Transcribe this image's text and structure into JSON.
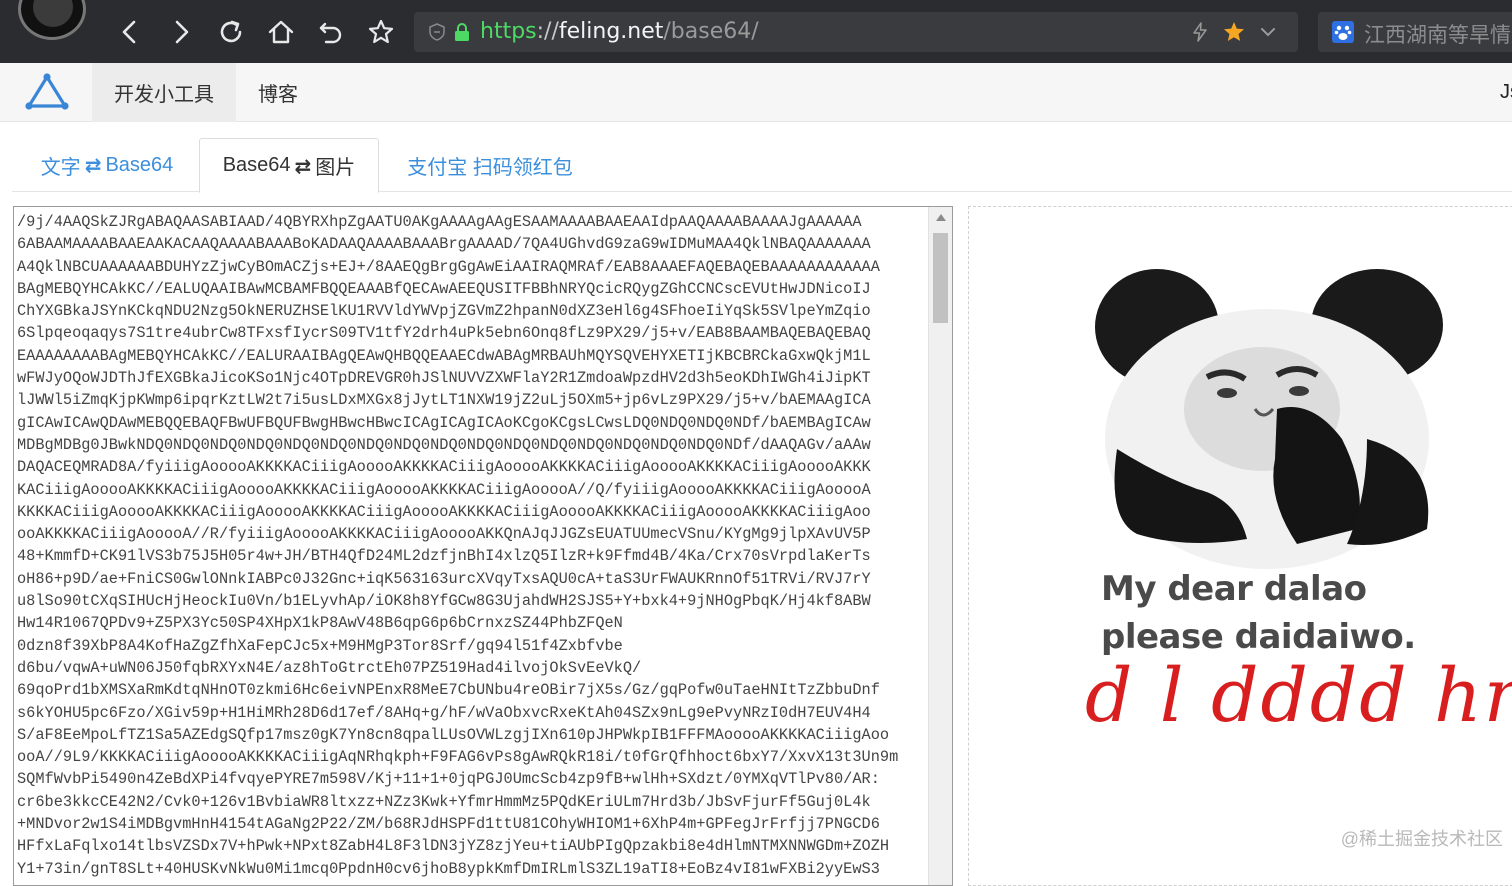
{
  "browser": {
    "url": {
      "scheme": "https",
      "sep": "://",
      "host": "feling.net",
      "path": "/base64/"
    },
    "search_text": "江西湖南等旱情加",
    "colors": {
      "url_green": "#4cd964",
      "star": "#f5a623",
      "chrome_bg": "#2b2c30"
    }
  },
  "site": {
    "menu": [
      {
        "label": "开发小工具"
      },
      {
        "label": "博客"
      }
    ],
    "right_text": "Js"
  },
  "tabs": [
    {
      "text": "文字",
      "arrow": "⇄",
      "text2": "Base64"
    },
    {
      "text": "Base64",
      "arrow": "⇄",
      "text2": "图片"
    },
    {
      "text": "支付宝 扫码领红包"
    }
  ],
  "base64_lines": [
    "/9j/4AAQSkZJRgABAQAASABIAAD/4QBYRXhpZgAATU0AKgAAAAgAAgESAAMAAAABAAEAAIdpAAQAAAABAAAAJgAAAAAA",
    "6ABAAMAAAABAAEAAKACAAQAAAABAAABoKADAAQAAAABAAABrgAAAAD/7QA4UGhvdG9zaG9wIDMuMAA4QklNBAQAAAAAAA",
    "A4QklNBCUAAAAAABDUHYzZjwCyBOmACZjs+EJ+/8AAEQgBrgGgAwEiAAIRAQMRAf/EAB8AAAEFAQEBAQEBAAAAAAAAAAAA",
    "BAgMEBQYHCAkKC//EALUQAAIBAwMCBAMFBQQEAAABfQECAwAEEQUSITFBBhNRYQcicRQygZGhCCNCscEVUtHwJDNicoIJ",
    "ChYXGBkaJSYnKCkqNDU2Nzg5OkNERUZHSElKU1RVVldYWVpjZGVmZ2hpanN0dXZ3eHl6g4SFhoeIiYqSk5SVlpeYmZqio",
    "6Slpqeoqaqys7S1tre4ubrCw8TFxsfIycrS09TV1tfY2drh4uPk5ebn6Onq8fLz9PX29/j5+v/EAB8BAAMBAQEBAQEBAQ",
    "EAAAAAAAABAgMEBQYHCAkKC//EALURAAIBAgQEAwQHBQQEAAECdwABAgMRBAUhMQYSQVEHYXETIjKBCBRCkaGxwQkjM1L",
    "wFWJyOQoWJDThJfEXGBkaJicoKSo1Njc4OTpDREVGR0hJSlNUVVZXWFlaY2R1ZmdoaWpzdHV2d3h5eoKDhIWGh4iJipKT",
    "lJWWl5iZmqKjpKWmp6ipqrKztLW2t7i5usLDxMXGx8jJytLT1NXW19jZ2uLj5OXm5+jp6vLz9PX29/j5+v/bAEMAAgICA",
    "gICAwICAwQDAwMEBQQEBAQFBwUFBQUFBwgHBwcHBwcICAgICAgICAoKCgoKCgsLCwsLDQ0NDQ0NDQ0NDf/bAEMBAgICAw",
    "MDBgMDBg0JBwkNDQ0NDQ0NDQ0NDQ0NDQ0NDQ0NDQ0NDQ0NDQ0NDQ0NDQ0NDQ0NDQ0NDQ0NDQ0NDQ0NDf/dAAQAGv/aAAw",
    "DAQACEQMRAD8A/fyiiigAooooAKKKKACiiigAooooAKKKKACiiigAooooAKKKKACiiigAooooAKKKKACiiigAooooAKKK",
    "KACiiigAooooAKKKKACiiigAooooAKKKKACiiigAooooAKKKKACiiigAooooA//Q/fyiiigAooooAKKKKACiiigAooooA",
    "KKKKACiiigAooooAKKKKACiiigAooooAKKKKACiiigAooooAKKKKACiiigAooooAKKKKACiiigAooooAKKKKACiiigAoo",
    "ooAKKKKACiiigAooooA//R/fyiiigAooooAKKKKACiiigAooooAKKQnAJqJJGZsEUATUUmecVSnu/KYgMg9jlpXAvUV5P",
    "48+KmmfD+CK91lVS3b75J5H05r4w+JH/BTH4QfD24ML2dzfjnBhI4xlzQ5IlzR+k9Ffmd4B/4Ka/Crx70sVrpdlaKerTs",
    "oH86+p9D/ae+FniCS0GwlONnkIABPc0J32Gnc+iqK563163urcXVqyTxsAQU0cA+taS3UrFWAUKRnnOf51TRVi/RVJ7rY",
    "u8lSo90tCXqSIHUcHjHeockIu0Vn/b1ELyvhAp/iOK8h8YfGCw8G3UjahdWH2SJS5+Y+bxk4+9jNHOgPbqK/Hj4kf8ABW",
    "Hw14R1067QPDv9+Z5PX3Yc50SP4XHpX1kP8AwV48B6qpG6p6bCrnxzSZ44PhbZFQeN",
    "0dzn8f39XbP8A4KofHaZgZfhXaFepCJc5x+M9HMgP3Tor8Srf/gq94l51f4Zxbfvbe",
    "d6bu/vqwA+uWN06J50fqbRXYxN4E/az8hToGtrctEh07PZ519Had4ilvojOkSvEeVkQ/",
    "69qoPrd1bXMSXaRmKdtqNHnOT0zkmi6Hc6eivNPEnxR8MeE7CbUNbu4reOBir7jX5s/Gz/gqPofw0uTaeHNItTzZbbuDnf",
    "s6kYOHU5pc6Fzo/XGiv59p+H1HiMRh28D6d17ef/8AHq+g/hF/wVaObxvcRxeKtAh04SZx9nLg9ePvyNRzI0dH7EUV4H4",
    "S/aF8EeMpoLfTZ1Sa5AZEdgSQfp17msz0gK7Yn8cn8qpalLUsOVWLzgjIXn610pJHPWkpIB1FFFMAooooAKKKKACiiigAoo",
    "ooA//9L9/KKKKACiiigAooooAKKKKACiiigAqNRhqkph+F9FAG6vPs8gAwRQkR18i/t0fGrQfhhoct6bxY7/XxvX13t3Un9m",
    "SQMfWvbPi5490n4ZeBdXPi4fvqyePYRE7m598V/Kj+11+1+0jqPGJ0UmcScb4zp9fB+wlHh+SXdzt/0YMXqVTlPv80/AR:",
    "cr6be3kkcCE42N2/Cvk0+126v1BvbiaWR8ltxzz+NZz3Kwk+YfmrHmmMz5PQdKEriULm7Hrd3b/JbSvFjurFf5Guj0L4k",
    "+MNDvor2w1S4iMDBgvmHnH4154tAGaNg2P22/ZM/b68RJdHSPFd1ttU81COhyWHIOM1+6XhP4m+GPFegJrFrfjj7PNGCD6",
    "HFfxLaFqlxo14tlbsVZSDx7V+hPwk+NPxt8ZabH4L8F3lDN3jYZ8zjYeu+tiAUbPIgQpzakbi8e4dHlmNTMXNNWGDm+ZOZH",
    "Y1+73in/gnT8SLt+40HUSKvNkWu0Mi1mcq0PpdnH0cv6jhoB8ypkKmfDmIRLmlS3ZL19aTI8+EoBz4vI81wFXBi2yyEwS3"
  ],
  "preview": {
    "caption": "My dear dalao please daidaiwo.",
    "handwriting": "d l dddd hm",
    "watermark": "@稀土掘金技术社区"
  }
}
